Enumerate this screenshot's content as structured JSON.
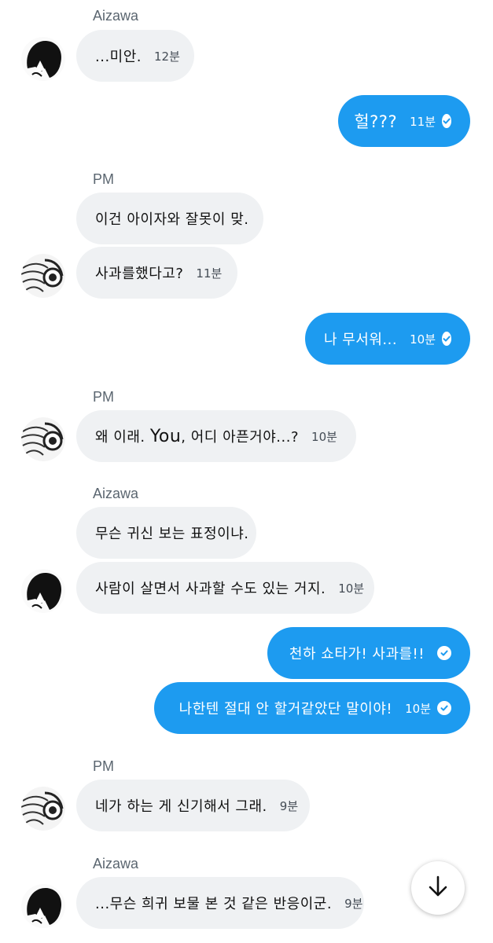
{
  "messages": [
    {
      "sender": "Aizawa"
    },
    {
      "text": "...미안.",
      "time": "12분"
    },
    {
      "text": "헐???",
      "time": "11분"
    },
    {
      "sender": "PM"
    },
    {
      "text": "이건 아이자와 잘못이 맞."
    },
    {
      "text": "사과를했다고?",
      "time": "11분"
    },
    {
      "text": "나 무서워...",
      "time": "10분"
    },
    {
      "sender": "PM"
    },
    {
      "text_prefix": "왜 이래. ",
      "text_you": "You",
      "text_suffix": ", 어디 아픈거야...?",
      "time": "10분"
    },
    {
      "sender": "Aizawa"
    },
    {
      "text": "무슨 귀신 보는 표정이냐."
    },
    {
      "text": "사람이 살면서 사과할 수도 있는 거지.",
      "time": "10분"
    },
    {
      "text": "천하 쇼타가! 사과를!!"
    },
    {
      "text": "나한텐 절대 안 할거같았단 말이야!",
      "time": "10분"
    },
    {
      "sender": "PM"
    },
    {
      "text": "네가 하는 게 신기해서 그래.",
      "time": "9분"
    },
    {
      "sender": "Aizawa"
    },
    {
      "text": "...무슨 희귀 보물 본 것 같은 반응이군.",
      "time": "9분"
    }
  ],
  "icons": {
    "read": "check-circle-icon",
    "scroll": "arrow-down-icon"
  },
  "colors": {
    "outgoing_bubble": "#1d9bf0",
    "incoming_bubble": "#eff1f3",
    "sender_name": "#5b6670"
  }
}
